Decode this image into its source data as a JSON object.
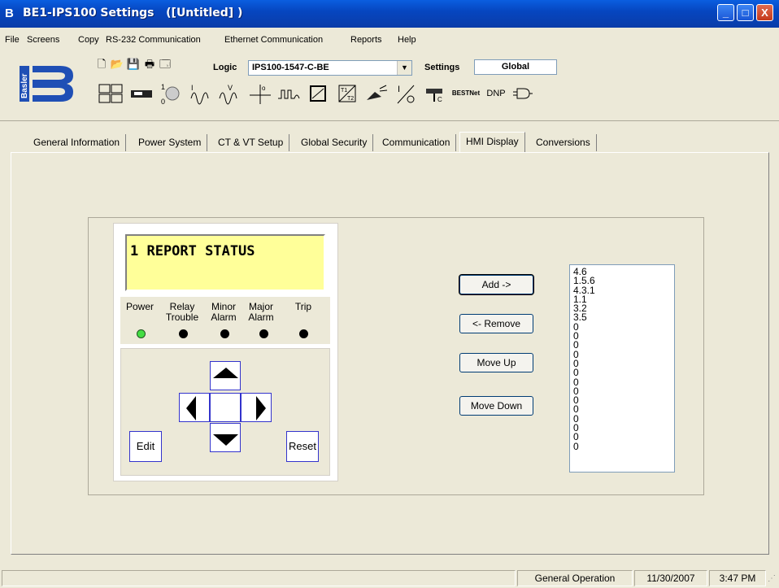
{
  "window": {
    "title": "BE1-IPS100 Settings   ([Untitled] )",
    "minimize_glyph": "_",
    "maximize_glyph": "□",
    "close_glyph": "X"
  },
  "menu": [
    "File",
    "Screens",
    "Copy",
    "RS-232 Communication",
    "Ethernet Communication",
    "Reports",
    "Help"
  ],
  "toolbar": {
    "logic_label": "Logic",
    "logic_value": "IPS100-1547-C-BE",
    "settings_label": "Settings",
    "settings_value": "Global",
    "logo_text": "Basler",
    "bestnet_label": "BESTNet",
    "dnp_label": "DNP"
  },
  "tabs": [
    {
      "label": "General Information",
      "active": false
    },
    {
      "label": "Power System",
      "active": false
    },
    {
      "label": "CT & VT Setup",
      "active": false
    },
    {
      "label": "Global Security",
      "active": false
    },
    {
      "label": "Communication",
      "active": false
    },
    {
      "label": "HMI Display",
      "active": true
    },
    {
      "label": "Conversions",
      "active": false
    }
  ],
  "hmi": {
    "lcd_text": "1 REPORT STATUS",
    "leds": [
      {
        "label": "Power",
        "on": true
      },
      {
        "label": "Relay\nTrouble",
        "on": false
      },
      {
        "label": "Minor\nAlarm",
        "on": false
      },
      {
        "label": "Major\nAlarm",
        "on": false
      },
      {
        "label": "Trip",
        "on": false
      }
    ],
    "edit_label": "Edit",
    "reset_label": "Reset"
  },
  "buttons": {
    "add": "Add ->",
    "remove": "<- Remove",
    "move_up": "Move Up",
    "move_down": "Move Down"
  },
  "screen_list": [
    "4.6",
    "1.5.6",
    "4.3.1",
    "1.1",
    "3.2",
    "3.5",
    "0",
    "0",
    "0",
    "0",
    "0",
    "0",
    "0",
    "0",
    "0",
    "0",
    "0",
    "0",
    "0",
    "0"
  ],
  "status": {
    "mode": "General Operation",
    "date": "11/30/2007",
    "time": "3:47 PM"
  },
  "colors": {
    "titlebar": "#0a5ee0",
    "lcd": "#ffff99",
    "power_led": "#44dd44",
    "key_border": "#3333cc"
  }
}
